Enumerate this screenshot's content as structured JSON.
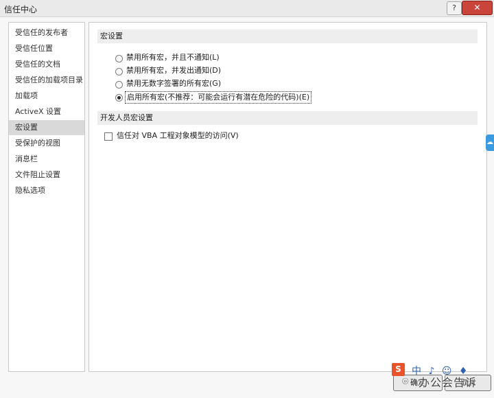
{
  "window": {
    "title": "信任中心",
    "help_label": "?",
    "close_label": "✕"
  },
  "sidebar": {
    "items": [
      {
        "label": "受信任的发布者"
      },
      {
        "label": "受信任位置"
      },
      {
        "label": "受信任的文档"
      },
      {
        "label": "受信任的加载项目录"
      },
      {
        "label": "加载项"
      },
      {
        "label": "ActiveX 设置"
      },
      {
        "label": "宏设置",
        "selected": true
      },
      {
        "label": "受保护的视图"
      },
      {
        "label": "消息栏"
      },
      {
        "label": "文件阻止设置"
      },
      {
        "label": "隐私选项"
      }
    ]
  },
  "macro_settings": {
    "header": "宏设置",
    "options": [
      {
        "label": "禁用所有宏，并且不通知(L)",
        "selected": false
      },
      {
        "label": "禁用所有宏，并发出通知(D)",
        "selected": false
      },
      {
        "label": "禁用无数字签署的所有宏(G)",
        "selected": false
      },
      {
        "label": "启用所有宏(不推荐：可能会运行有潜在危险的代码)(E)",
        "selected": true
      }
    ]
  },
  "developer_settings": {
    "header": "开发人员宏设置",
    "vba_access": {
      "label": "信任对 VBA 工程对象模型的访问(V)",
      "checked": false
    }
  },
  "footer": {
    "ok_label": "确定",
    "cancel_label": "取消"
  },
  "watermark": {
    "logo_letter": "S",
    "toolbar_glyphs": "中 ♪ ☺ ♦",
    "text": "办公会告诉"
  },
  "side_tab": {
    "icon": "cloud-icon",
    "glyph": "☁"
  }
}
